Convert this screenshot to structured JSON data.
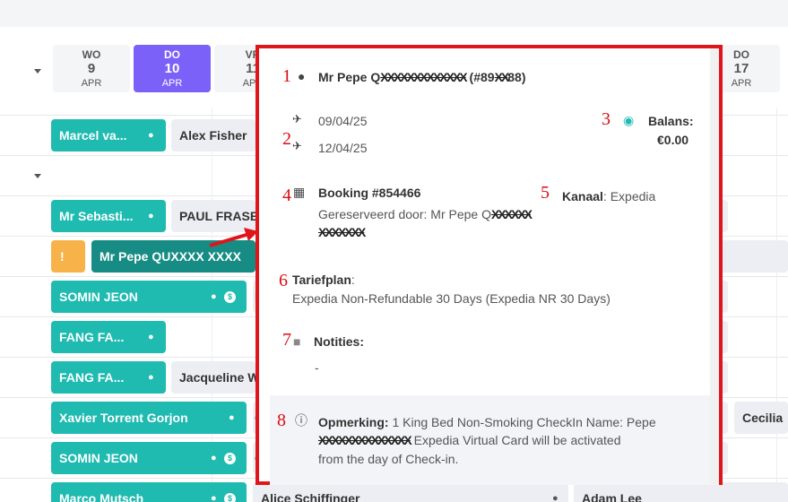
{
  "calendar": {
    "days": [
      {
        "name": "WO",
        "num": "9",
        "month": "APR",
        "active": false
      },
      {
        "name": "DO",
        "num": "10",
        "month": "APR",
        "active": true
      },
      {
        "name": "VR",
        "num": "11",
        "month": "APR",
        "active": false
      },
      {
        "name": "DO",
        "num": "17",
        "month": "APR",
        "active": false
      }
    ],
    "rows": [
      {
        "main": "Marcel va...",
        "next": "Alex Fisher"
      },
      {
        "main": "Mr Sebasti...",
        "next": "PAUL FRASER"
      },
      {
        "main": "Mr Pepe QUXXXX XXXX",
        "flag": "!"
      },
      {
        "main": "SOMIN JEON",
        "next": "El"
      },
      {
        "main": "FANG FA..."
      },
      {
        "main": "FANG FA...",
        "next": "Jacqueline Wi"
      },
      {
        "main": "Xavier Torrent Gorjon",
        "next": "Ch",
        "far": "Cecilia"
      },
      {
        "main": "SOMIN JEON",
        "next": "Ca"
      },
      {
        "main": "Marco Mutsch",
        "next": "Alice Schiffinger",
        "far": "Adam Lee"
      }
    ]
  },
  "popup": {
    "guest_prefix": "Mr Pepe Q",
    "guest_redacted": "XXXXXXXXXXXXX",
    "guest_suffix": " (#89",
    "guest_id_redacted": "XX",
    "guest_id_end": "88)",
    "arrival": "09/04/25",
    "departure": "12/04/25",
    "balance_label": "Balans:",
    "balance_value": "€0.00",
    "booking": "Booking #854466",
    "reserved_by": "Gereserveerd door: Mr Pepe Q",
    "reserved_redacted_1": "XXXXXX",
    "reserved_redacted_2": "XXXXXXX",
    "channel_label": "Kanaal",
    "channel_value": ": Expedia",
    "rateplan_label": "Tariefplan",
    "rateplan_colon": ":",
    "rateplan_value": "Expedia Non-Refundable 30 Days (Expedia NR 30 Days)",
    "notes_label": "Notities:",
    "notes_value": "-",
    "remark_label": "Opmerking:",
    "remark_line1": " 1 King Bed Non-Smoking CheckIn Name: Pepe",
    "remark_redacted": "XXXXXXXXXXXXXX",
    "remark_line2": " Expedia Virtual Card will be activated",
    "remark_line3": "from the day of Check-in."
  },
  "annotations": [
    "1",
    "2",
    "3",
    "4",
    "5",
    "6",
    "7",
    "8"
  ],
  "icons": {
    "guest": "person-icon",
    "arrival": "plane-landing-icon",
    "departure": "plane-takeoff-icon",
    "balance": "coin-icon",
    "booking": "calendar-icon",
    "notes": "chat-icon",
    "remark": "info-icon"
  },
  "colors": {
    "accent": "#7b61f7",
    "teal": "#1fbab0",
    "dark_teal": "#178c84",
    "highlight_border": "#e0151b",
    "annotation_red": "#d80e15"
  }
}
